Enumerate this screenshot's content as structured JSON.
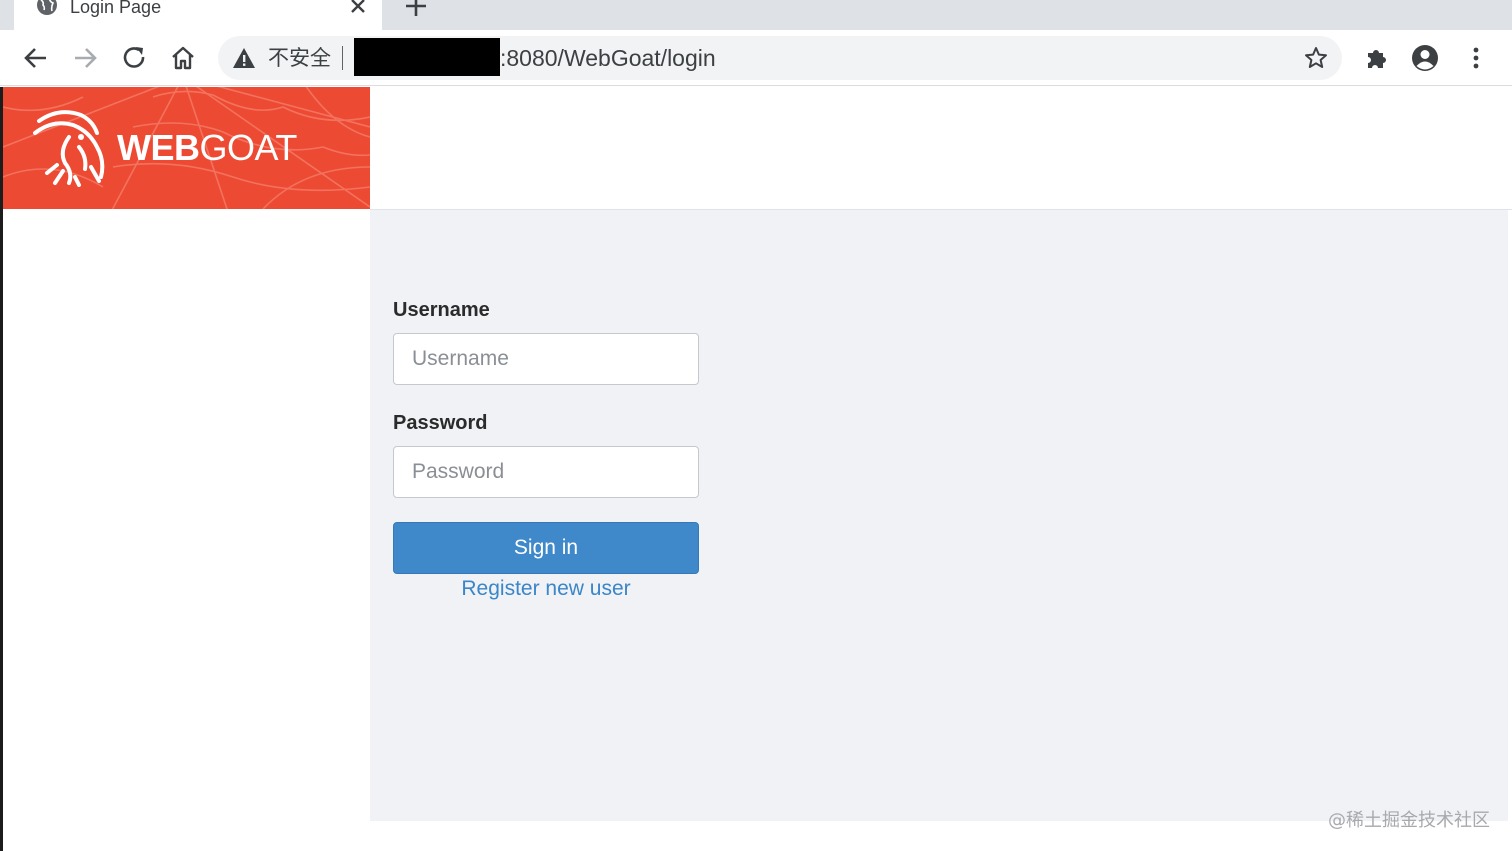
{
  "browser": {
    "tab": {
      "title": "Login Page"
    },
    "omnibox": {
      "security_label": "不安全",
      "url": ":8080/WebGoat/login"
    },
    "icons": {
      "tab": "globe-icon",
      "tab_close": "close-icon",
      "new_tab": "plus-icon",
      "back": "arrow-left-icon",
      "forward": "arrow-right-icon",
      "reload": "reload-icon",
      "home": "home-icon",
      "warning": "warning-icon",
      "bookmark": "star-icon",
      "extensions": "puzzle-icon",
      "profile": "account-icon",
      "menu": "kebab-menu-icon"
    }
  },
  "brand": {
    "name_bold": "WEB",
    "name_regular": "GOAT",
    "color": "#ed4a34",
    "logo_icon": "goat-logo-icon"
  },
  "login": {
    "username_label": "Username",
    "username_placeholder": "Username",
    "username_value": "",
    "password_label": "Password",
    "password_placeholder": "Password",
    "password_value": "",
    "signin_label": "Sign in",
    "register_label": "Register new user",
    "accent_color": "#3f89cb",
    "link_color": "#3a86c8"
  },
  "watermark": "@稀土掘金技术社区"
}
